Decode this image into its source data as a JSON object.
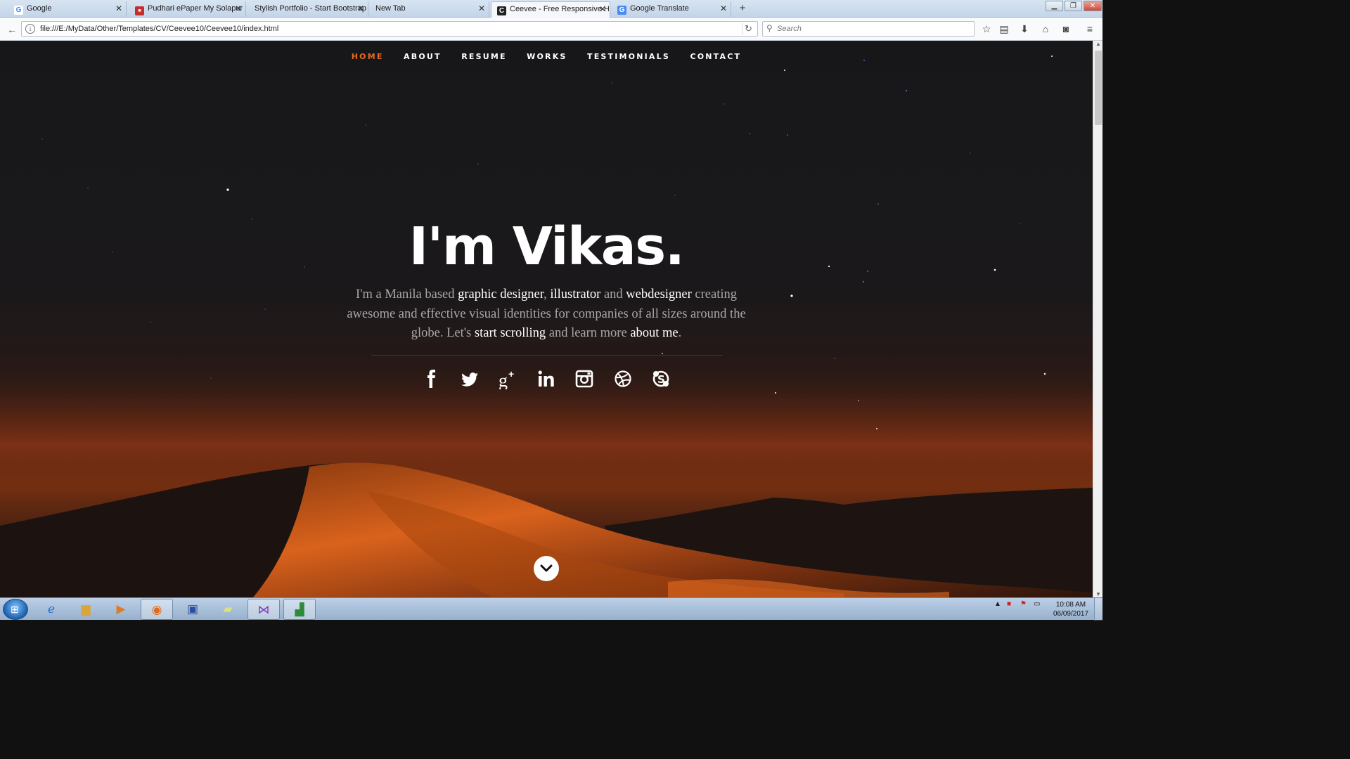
{
  "browser": {
    "tabs": [
      {
        "title": "Google",
        "icon": "google-g-icon"
      },
      {
        "title": "Pudhari ePaper My Solapur E",
        "icon": "pdf-icon"
      },
      {
        "title": "Stylish Portfolio - Start Bootstrap",
        "icon": "none"
      },
      {
        "title": "New Tab",
        "icon": "none"
      },
      {
        "title": "Ceevee - Free Responsive HT",
        "icon": "ceevee-c-icon",
        "active": true
      },
      {
        "title": "Google Translate",
        "icon": "google-translate-icon"
      }
    ],
    "url": "file:///E:/MyData/Other/Templates/CV/Ceevee10/Ceevee10/index.html",
    "search_placeholder": "Search"
  },
  "site": {
    "nav": [
      {
        "label": "HOME",
        "active": true
      },
      {
        "label": "ABOUT"
      },
      {
        "label": "RESUME"
      },
      {
        "label": "WORKS"
      },
      {
        "label": "TESTIMONIALS"
      },
      {
        "label": "CONTACT"
      }
    ],
    "hero": {
      "title": "I'm Vikas.",
      "desc": {
        "p1": "I'm a Manila based ",
        "h1": "graphic designer",
        "p2": ", ",
        "h2": "illustrator",
        "p3": " and ",
        "h3": "webdesigner",
        "p4": " creating awesome and effective visual identities for companies of all sizes around the globe. Let's ",
        "h4": "start scrolling",
        "p5": " and learn more ",
        "h5": "about me",
        "p6": "."
      }
    },
    "social": [
      "facebook-icon",
      "twitter-icon",
      "google-plus-icon",
      "linkedin-icon",
      "instagram-icon",
      "dribbble-icon",
      "skype-icon"
    ],
    "accent": "#e56a1f"
  },
  "taskbar": {
    "apps": [
      "internet-explorer-icon",
      "file-explorer-icon",
      "media-player-icon",
      "firefox-icon",
      "network-icon",
      "sticky-notes-icon",
      "visual-studio-icon",
      "project-icon"
    ],
    "time": "10:08 AM",
    "date": "06/09/2017"
  }
}
